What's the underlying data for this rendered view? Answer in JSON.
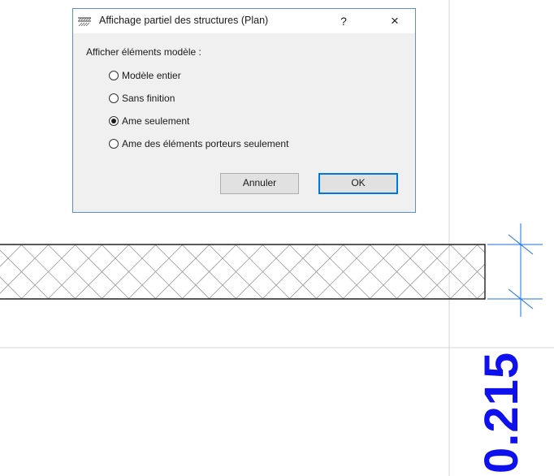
{
  "dialog": {
    "title": "Affichage partiel des structures (Plan)",
    "help_label": "?",
    "close_label": "×",
    "group_label": "Afficher éléments modèle :",
    "options": [
      {
        "label": "Modèle entier",
        "selected": false
      },
      {
        "label": "Sans finition",
        "selected": false
      },
      {
        "label": "Ame seulement",
        "selected": true
      },
      {
        "label": "Ame des éléments porteurs seulement",
        "selected": false
      }
    ],
    "cancel_label": "Annuler",
    "ok_label": "OK"
  },
  "drawing": {
    "dimension_value": "0.215",
    "dimension_color": "#0f10ee",
    "guide_color": "#cfcfcf",
    "hatch_color": "#9a9a9a"
  }
}
